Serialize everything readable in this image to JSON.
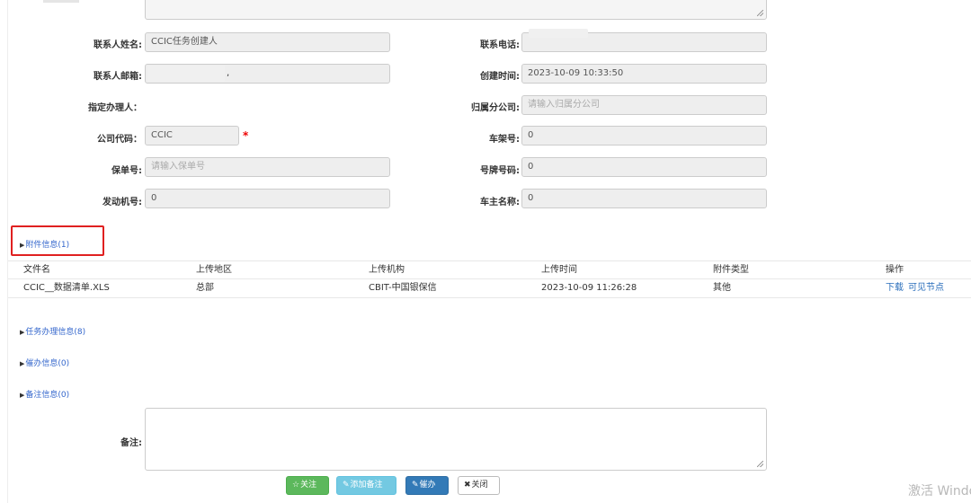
{
  "form": {
    "contact_name_label": "联系人姓名:",
    "contact_name_value": "CCIC任务创建人",
    "contact_phone_label": "联系电话:",
    "contact_email_label": "联系人邮箱:",
    "contact_email_value": ",",
    "created_time_label": "创建时间:",
    "created_time_value": "2023-10-09 10:33:50",
    "assignee_label": "指定办理人：",
    "branch_label": "归属分公司:",
    "branch_placeholder": "请输入归属分公司",
    "company_code_label": "公司代码：",
    "company_code_value": "CCIC",
    "required_mark": "*",
    "vin_label": "车架号:",
    "vin_value": "0",
    "policy_no_label": "保单号:",
    "policy_no_placeholder": "请输入保单号",
    "plate_label": "号牌号码:",
    "plate_value": "0",
    "engine_no_label": "发动机号:",
    "engine_no_value": "0",
    "owner_label": "车主名称:",
    "owner_value": "0"
  },
  "sections": {
    "attachments": "附件信息(1)",
    "tasks": "任务办理信息(8)",
    "reminders": "催办信息(0)",
    "notes": "备注信息(0)"
  },
  "attachment_table": {
    "headers": [
      "文件名",
      "上传地区",
      "上传机构",
      "上传时间",
      "附件类型",
      "操作"
    ],
    "rows": [
      {
        "file_name": "CCIC__数据清单.XLS",
        "region": "总部",
        "org": "CBIT-中国银保信",
        "time": "2023-10-09 11:26:28",
        "type": "其他",
        "actions": [
          "下载",
          "可见节点"
        ]
      }
    ]
  },
  "remark": {
    "label": "备注:"
  },
  "buttons": {
    "follow": "关注",
    "add_note": "添加备注",
    "urge": "催办",
    "close": "关闭"
  },
  "watermark": "激活 Windo"
}
